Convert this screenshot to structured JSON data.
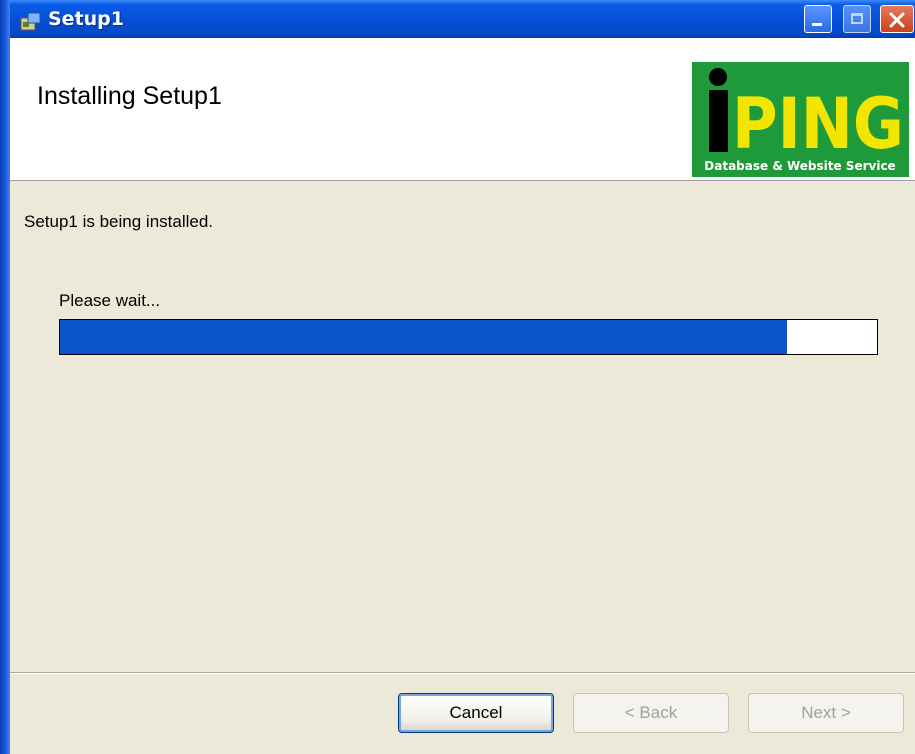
{
  "window": {
    "title": "Setup1",
    "minimize": "minimize",
    "maximize": "maximize",
    "close": "close"
  },
  "banner": {
    "heading": "Installing Setup1",
    "logo_text": "PING",
    "logo_tagline": "Database & Website Service"
  },
  "content": {
    "status": "Setup1 is being installed.",
    "wait": "Please wait...",
    "progress_fraction": 0.89
  },
  "buttons": {
    "cancel": "Cancel",
    "back": "< Back",
    "next": "Next >"
  },
  "colors": {
    "progress_fill": "#0a55cc",
    "logo_green": "#1f9a3a",
    "logo_yellow": "#f2e600"
  }
}
